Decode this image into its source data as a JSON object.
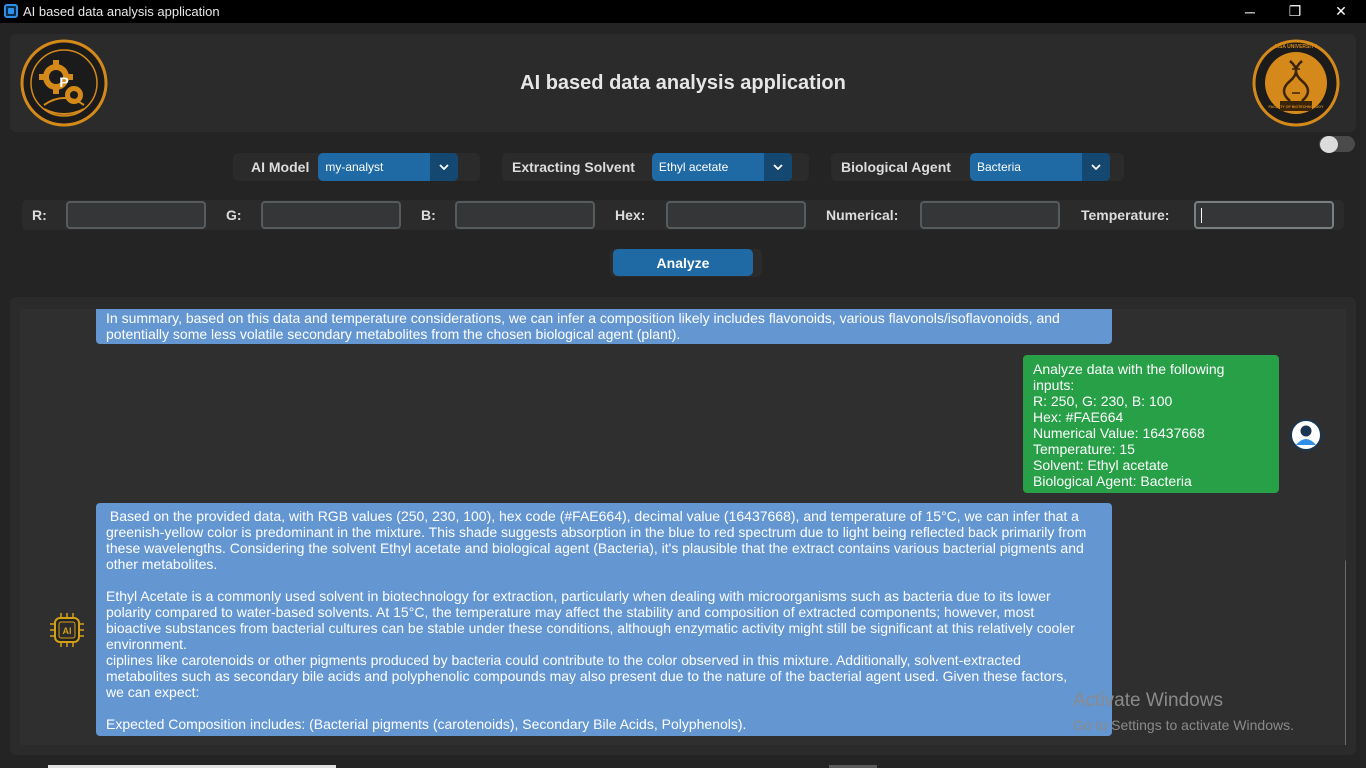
{
  "window": {
    "title": "AI based data analysis application",
    "minimize_glyph": "─",
    "maximize_glyph": "❐",
    "close_glyph": "✕"
  },
  "header": {
    "title": "AI based data analysis application",
    "left_logo": "faculty-gear-dna-logo",
    "right_logo": "msa-university-faculty-of-biotechnology-logo",
    "right_logo_text": "FACULTY OF BIOTECHNOLOGY",
    "right_logo_ring_text": "MSA UNIVERSITY",
    "left_logo_letter": "P"
  },
  "selectors": {
    "ai_model": {
      "label": "AI Model",
      "value": "my-analyst"
    },
    "solvent": {
      "label": "Extracting Solvent",
      "value": "Ethyl acetate"
    },
    "agent": {
      "label": "Biological Agent",
      "value": "Bacteria"
    }
  },
  "inputs": {
    "r": {
      "label": "R:",
      "value": ""
    },
    "g": {
      "label": "G:",
      "value": ""
    },
    "b": {
      "label": "B:",
      "value": ""
    },
    "hex": {
      "label": "Hex:",
      "value": ""
    },
    "numerical": {
      "label": "Numerical:",
      "value": ""
    },
    "temperature": {
      "label": "Temperature:",
      "value": ""
    }
  },
  "analyze_label": "Analyze",
  "chat": {
    "messages": [
      {
        "role": "ai",
        "text": "In summary, based on this data and temperature considerations, we can infer a composition likely includes flavonoids, various flavonols/isoflavonoids, and\npotentially some less volatile secondary metabolites from the chosen biological agent (plant)."
      },
      {
        "role": "user",
        "text": "Analyze data with the following inputs:\nR: 250, G: 230, B: 100\nHex: #FAE664\nNumerical Value: 16437668\nTemperature: 15\nSolvent: Ethyl acetate\nBiological Agent: Bacteria"
      },
      {
        "role": "ai",
        "text": " Based on the provided data, with RGB values (250, 230, 100), hex code (#FAE664), decimal value (16437668), and temperature of 15°C, we can infer that a\ngreenish-yellow color is predominant in the mixture. This shade suggests absorption in the blue to red spectrum due to light being reflected back primarily from\nthese wavelengths. Considering the solvent Ethyl acetate and biological agent (Bacteria), it's plausible that the extract contains various bacterial pigments and\nother metabolites.\n\nEthyl Acetate is a commonly used solvent in biotechnology for extraction, particularly when dealing with microorganisms such as bacteria due to its lower\npolarity compared to water-based solvents. At 15°C, the temperature may affect the stability and composition of extracted components; however, most\nbioactive substances from bacterial cultures can be stable under these conditions, although enzymatic activity might still be significant at this relatively cooler\nenvironment.\nciplines like carotenoids or other pigments produced by bacteria could contribute to the color observed in this mixture. Additionally, solvent-extracted\nmetabolites such as secondary bile acids and polyphenolic compounds may also present due to the nature of the bacterial agent used. Given these factors,\nwe can expect:\n\nExpected Composition includes: (Bacterial pigments (carotenoids), Secondary Bile Acids, Polyphenols)."
      }
    ],
    "user_avatar_icon": "user-avatar-icon",
    "ai_avatar_icon": "ai-chip-icon",
    "ai_chip_label": "AI"
  },
  "watermark": {
    "line1": "Activate Windows",
    "line2": "Go to Settings to activate Windows."
  },
  "colors": {
    "accent": "#1f6aa5",
    "ai_bubble": "#6497d2",
    "user_bubble": "#27a048",
    "logo_gold": "#d4891a"
  }
}
